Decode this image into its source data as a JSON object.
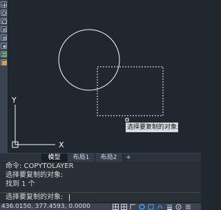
{
  "tabs": {
    "active": "模型",
    "items": [
      "布局1",
      "布局2"
    ],
    "add": "+"
  },
  "canvas": {
    "tooltip": "选择要复制的对象:",
    "ucs": {
      "x_label": "X",
      "y_label": "Y"
    }
  },
  "command": {
    "lines": [
      "命令: COPYTOLAYER",
      "选择要复制的对象:",
      "找到 1 个"
    ],
    "prompt": "选择要复制的对象:"
  },
  "status": {
    "coordinates": "436.0150, 377.4593, 0.0000"
  },
  "colors": {
    "background": "#21272f",
    "drawing": "#ffffff",
    "selection_dashed": "#ffffff",
    "status_icon": "#4aa3ff"
  },
  "icons": {
    "toolbar": [
      "pan-icon",
      "zoom-icon",
      "orbit-icon",
      "zoom-extents-icon",
      "view-cube-icon",
      "layer-icon",
      "grid-icon",
      "snap-icon",
      "palette-icon"
    ],
    "status": [
      "grid-icon",
      "snap-icon",
      "ortho-icon",
      "polar-icon",
      "osnap-icon",
      "otrack-icon",
      "lineweight-icon",
      "workspace-icon",
      "fullscreen-icon"
    ]
  }
}
